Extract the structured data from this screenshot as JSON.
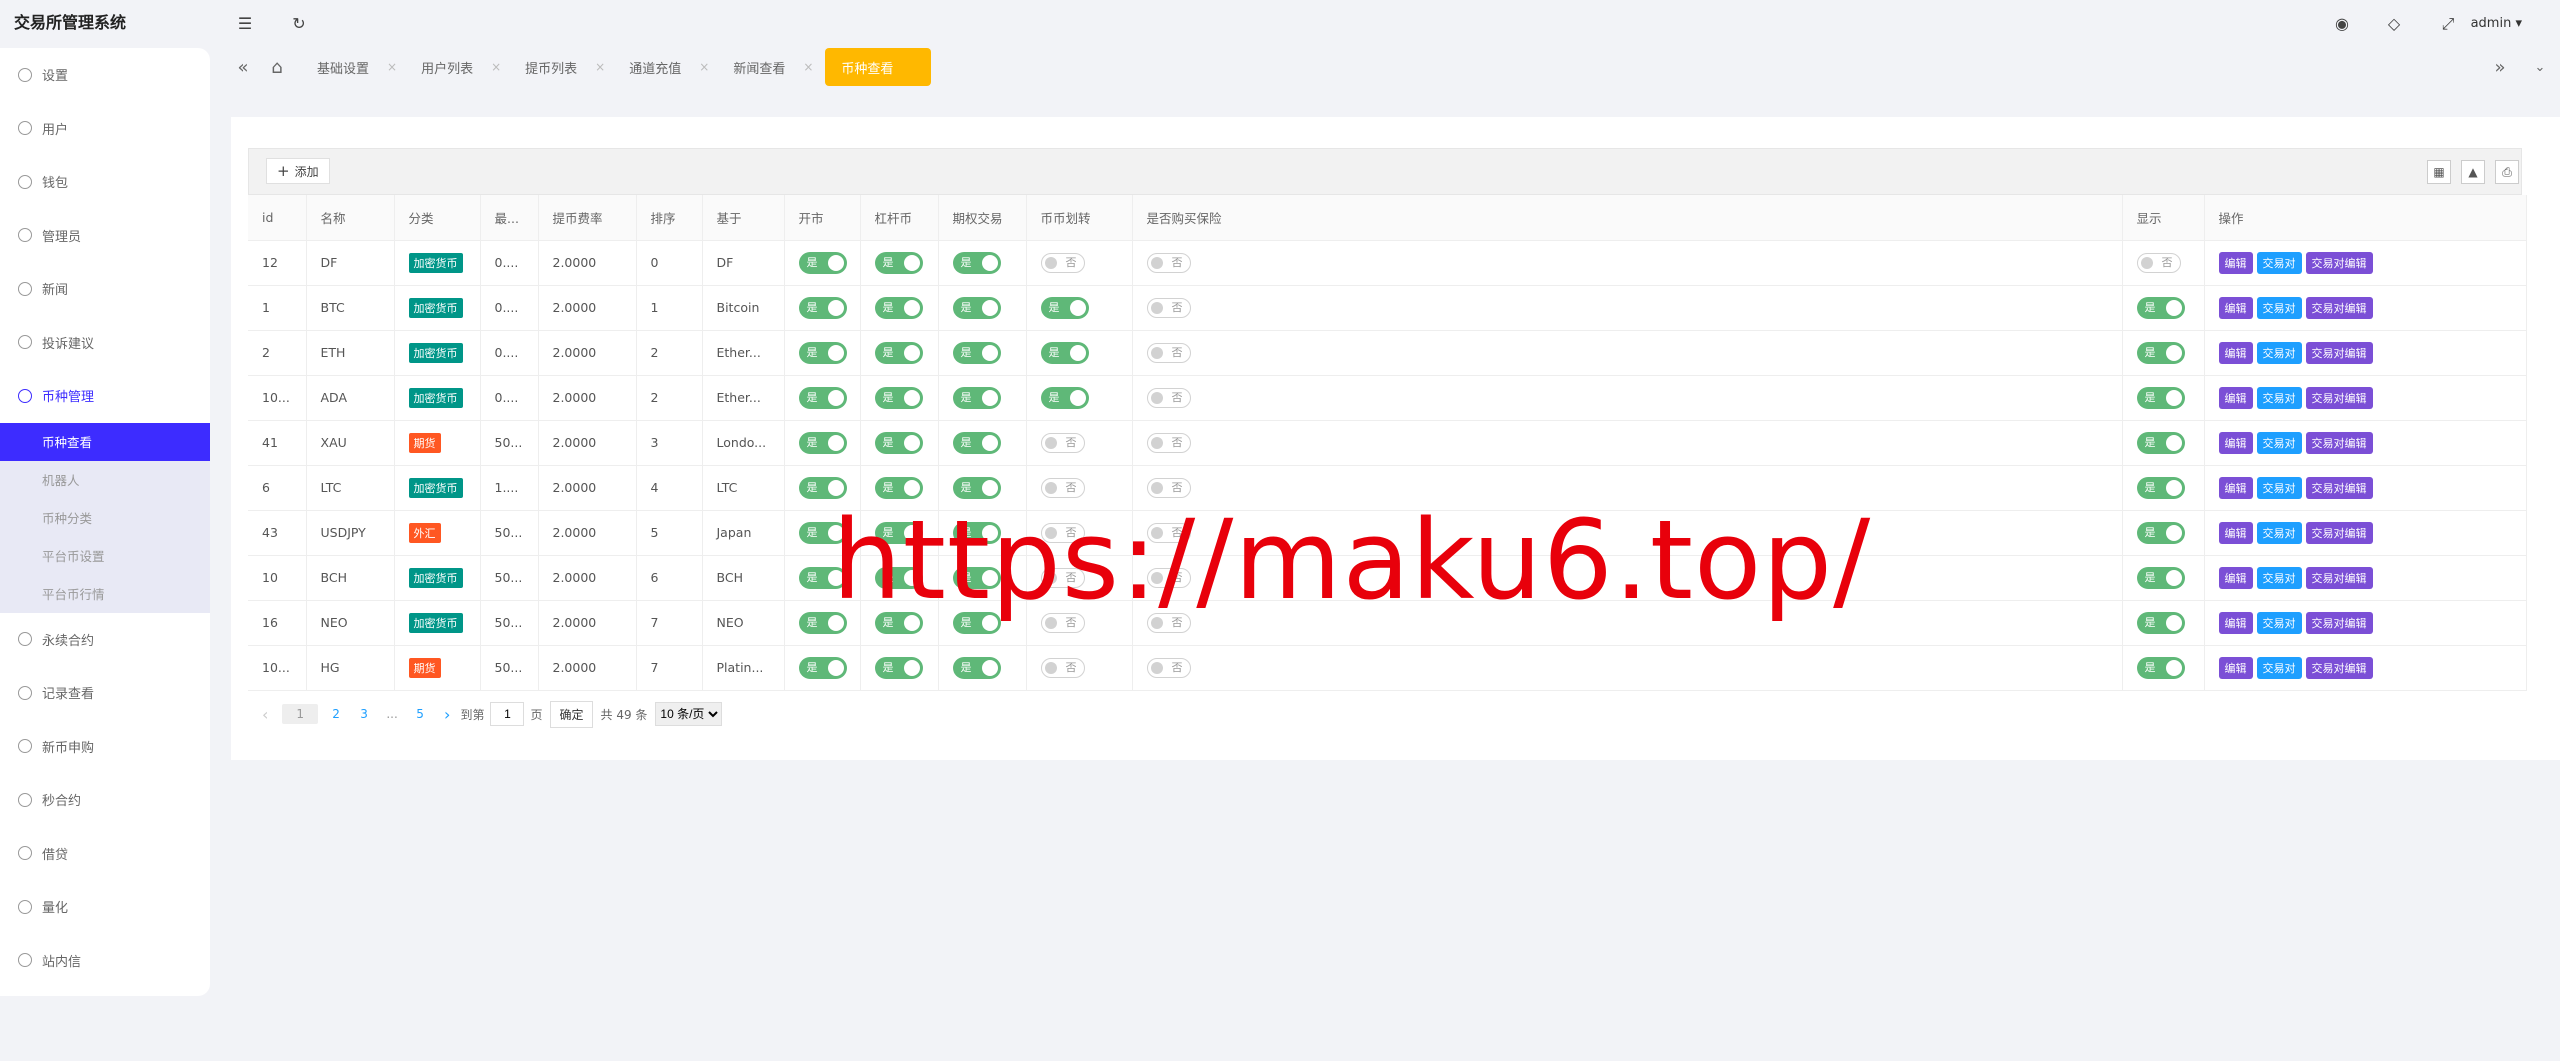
{
  "app_title": "交易所管理系统",
  "menu": [
    {
      "label": "设置",
      "active": false
    },
    {
      "label": "用户",
      "active": false
    },
    {
      "label": "钱包",
      "active": false
    },
    {
      "label": "管理员",
      "active": false
    },
    {
      "label": "新闻",
      "active": false
    },
    {
      "label": "投诉建议",
      "active": false
    },
    {
      "label": "币种管理",
      "active": true
    }
  ],
  "submenu": [
    {
      "label": "币种查看",
      "active": true
    },
    {
      "label": "机器人",
      "active": false
    },
    {
      "label": "币种分类",
      "active": false
    },
    {
      "label": "平台币设置",
      "active": false
    },
    {
      "label": "平台币行情",
      "active": false
    }
  ],
  "menu2": [
    "永续合约",
    "记录查看",
    "新币申购",
    "秒合约",
    "借贷",
    "量化",
    "站内信"
  ],
  "topbar": {
    "user": "admin"
  },
  "tabs": [
    "基础设置",
    "用户列表",
    "提币列表",
    "通道充值",
    "新闻查看"
  ],
  "active_tab": "币种查看",
  "toolbar": {
    "add_label": "添加"
  },
  "columns": [
    "id",
    "名称",
    "分类",
    "最...",
    "提币费率",
    "排序",
    "基于",
    "开市",
    "杠杆币",
    "期权交易",
    "币币划转",
    "是否购买保险",
    "显示",
    "操作"
  ],
  "rows": [
    {
      "id": "12",
      "name": "DF",
      "cat": "加密货币",
      "catc": "#009688",
      "min": "0....",
      "fee": "2.0000",
      "sort": "0",
      "base": "DF",
      "open": true,
      "lev": true,
      "opt": true,
      "tr": false,
      "ins": false,
      "show": false
    },
    {
      "id": "1",
      "name": "BTC",
      "cat": "加密货币",
      "catc": "#009688",
      "min": "0....",
      "fee": "2.0000",
      "sort": "1",
      "base": "Bitcoin",
      "open": true,
      "lev": true,
      "opt": true,
      "tr": true,
      "ins": false,
      "show": true
    },
    {
      "id": "2",
      "name": "ETH",
      "cat": "加密货币",
      "catc": "#009688",
      "min": "0....",
      "fee": "2.0000",
      "sort": "2",
      "base": "Ether...",
      "open": true,
      "lev": true,
      "opt": true,
      "tr": true,
      "ins": false,
      "show": true
    },
    {
      "id": "10...",
      "name": "ADA",
      "cat": "加密货币",
      "catc": "#009688",
      "min": "0....",
      "fee": "2.0000",
      "sort": "2",
      "base": "Ether...",
      "open": true,
      "lev": true,
      "opt": true,
      "tr": true,
      "ins": false,
      "show": true
    },
    {
      "id": "41",
      "name": "XAU",
      "cat": "期货",
      "catc": "#ff5722",
      "min": "50...",
      "fee": "2.0000",
      "sort": "3",
      "base": "Londo...",
      "open": true,
      "lev": true,
      "opt": true,
      "tr": false,
      "ins": false,
      "show": true
    },
    {
      "id": "6",
      "name": "LTC",
      "cat": "加密货币",
      "catc": "#009688",
      "min": "1....",
      "fee": "2.0000",
      "sort": "4",
      "base": "LTC",
      "open": true,
      "lev": true,
      "opt": true,
      "tr": false,
      "ins": false,
      "show": true
    },
    {
      "id": "43",
      "name": "USDJPY",
      "cat": "外汇",
      "catc": "#ff5722",
      "min": "50...",
      "fee": "2.0000",
      "sort": "5",
      "base": "Japan",
      "open": true,
      "lev": true,
      "opt": true,
      "tr": false,
      "ins": false,
      "show": true
    },
    {
      "id": "10",
      "name": "BCH",
      "cat": "加密货币",
      "catc": "#009688",
      "min": "50...",
      "fee": "2.0000",
      "sort": "6",
      "base": "BCH",
      "open": true,
      "lev": true,
      "opt": true,
      "tr": false,
      "ins": false,
      "show": true
    },
    {
      "id": "16",
      "name": "NEO",
      "cat": "加密货币",
      "catc": "#009688",
      "min": "50...",
      "fee": "2.0000",
      "sort": "7",
      "base": "NEO",
      "open": true,
      "lev": true,
      "opt": true,
      "tr": false,
      "ins": false,
      "show": true
    },
    {
      "id": "10...",
      "name": "HG",
      "cat": "期货",
      "catc": "#ff5722",
      "min": "50...",
      "fee": "2.0000",
      "sort": "7",
      "base": "Platin...",
      "open": true,
      "lev": true,
      "opt": true,
      "tr": false,
      "ins": false,
      "show": true
    }
  ],
  "switch_on": "是",
  "switch_off": "否",
  "actions": [
    {
      "label": "编辑",
      "color": "#7b4fd6"
    },
    {
      "label": "交易对",
      "color": "#1e9fff"
    },
    {
      "label": "交易对编辑",
      "color": "#7b4fd6"
    }
  ],
  "pager": {
    "pages": [
      "1",
      "2",
      "3",
      "...",
      "5"
    ],
    "goto": "到第",
    "goto_value": "1",
    "page_unit": "页",
    "confirm": "确定",
    "total": "共 49 条",
    "per_page": "10 条/页"
  },
  "watermark": "https://maku6.top/"
}
